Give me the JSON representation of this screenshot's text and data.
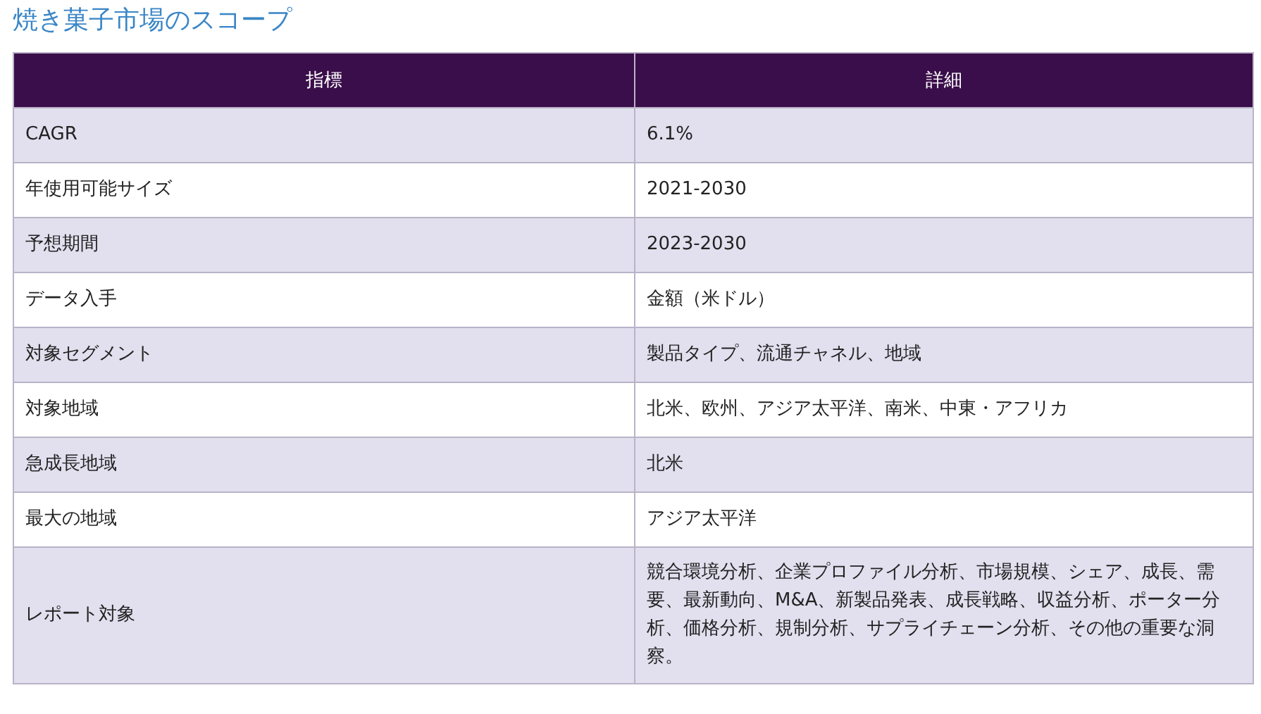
{
  "title": "焼き菓子市場のスコープ",
  "table": {
    "columns": [
      "指標",
      "詳細"
    ],
    "rows": [
      {
        "metric": "CAGR",
        "detail": "6.1%"
      },
      {
        "metric": "年使用可能サイズ",
        "detail": "2021-2030"
      },
      {
        "metric": "予想期間",
        "detail": "2023-2030"
      },
      {
        "metric": "データ入手",
        "detail": "金額（米ドル）"
      },
      {
        "metric": "対象セグメント",
        "detail": "製品タイプ、流通チャネル、地域"
      },
      {
        "metric": "対象地域",
        "detail": "北米、欧州、アジア太平洋、南米、中東・アフリカ"
      },
      {
        "metric": "急成長地域",
        "detail": "北米"
      },
      {
        "metric": "最大の地域",
        "detail": "アジア太平洋"
      },
      {
        "metric": "レポート対象",
        "detail": "競合環境分析、企業プロファイル分析、市場規模、シェア、成長、需要、最新動向、M&A、新製品発表、成長戦略、収益分析、ポーター分析、価格分析、規制分析、サプライチェーン分析、その他の重要な洞察。"
      }
    ]
  }
}
